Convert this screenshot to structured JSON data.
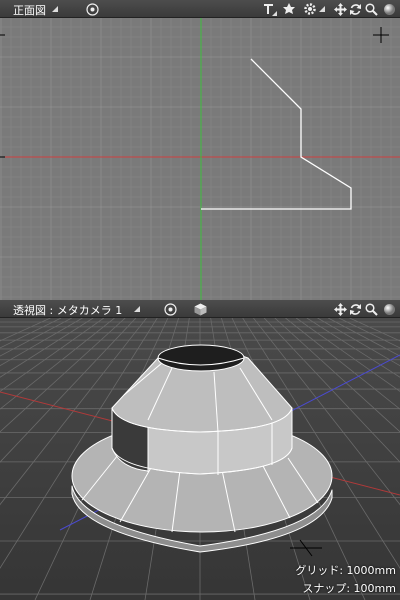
{
  "front_view": {
    "title": "正面図",
    "toolbar_icons": [
      "target-icon",
      "render-tool-icon",
      "light-tool-icon",
      "gear-icon",
      "pan-icon",
      "rotate-icon",
      "zoom-icon",
      "shading-ball-icon"
    ]
  },
  "perspective_view": {
    "title": "透視図 : メタカメラ 1",
    "toolbar_icons": [
      "target-icon",
      "cube-icon",
      "pan-icon",
      "rotate-icon",
      "zoom-icon",
      "shading-ball-icon"
    ],
    "grid_status": "グリッド: 1000mm",
    "snap_status": "スナップ: 100mm"
  },
  "colors": {
    "front_bg": "#7a7a7a",
    "front_grid": "#8a8a8a",
    "x_axis": "#d04040",
    "y_axis": "#3cc03c",
    "profile_line": "#ffffff",
    "persp_bg": "#3c3c3c",
    "model_face": "#a8a8a8"
  }
}
